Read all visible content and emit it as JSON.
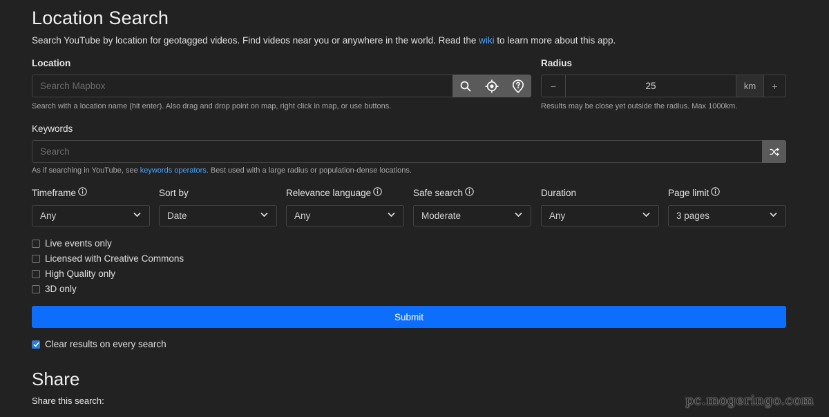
{
  "header": {
    "title": "Location Search",
    "intro_pre": "Search YouTube by location for geotagged videos. Find videos near you or anywhere in the world. Read the ",
    "intro_link": "wiki",
    "intro_post": " to learn more about this app."
  },
  "location": {
    "label": "Location",
    "placeholder": "Search Mapbox",
    "help": "Search with a location name (hit enter). Also drag and drop point on map, right click in map, or use buttons.",
    "buttons": [
      "search-icon",
      "crosshair-icon",
      "map-pin-question-icon"
    ]
  },
  "radius": {
    "label": "Radius",
    "minus": "−",
    "value": "25",
    "unit": "km",
    "plus": "+",
    "help": "Results may be close yet outside the radius. Max 1000km."
  },
  "keywords": {
    "label": "Keywords",
    "placeholder": "Search",
    "help_pre": "As if searching in YouTube, see ",
    "help_link": "keywords operators",
    "help_post": ". Best used with a large radius or population-dense locations."
  },
  "filters": {
    "timeframe": {
      "label": "Timeframe",
      "value": "Any"
    },
    "sort_by": {
      "label": "Sort by",
      "value": "Date"
    },
    "relevance_language": {
      "label": "Relevance language",
      "value": "Any"
    },
    "safe_search": {
      "label": "Safe search",
      "value": "Moderate"
    },
    "duration": {
      "label": "Duration",
      "value": "Any"
    },
    "page_limit": {
      "label": "Page limit",
      "value": "3 pages"
    }
  },
  "options": {
    "live": "Live events only",
    "cc": "Licensed with Creative Commons",
    "hq": "High Quality only",
    "three_d": "3D only"
  },
  "submit": "Submit",
  "clear_results": {
    "label": "Clear results on every search",
    "checked": true
  },
  "share": {
    "title": "Share",
    "subtitle": "Share this search:"
  },
  "watermark": "pc.mogeringo.com",
  "colors": {
    "accent": "#0d6efd",
    "link": "#4aa3ff",
    "background": "#222222"
  }
}
